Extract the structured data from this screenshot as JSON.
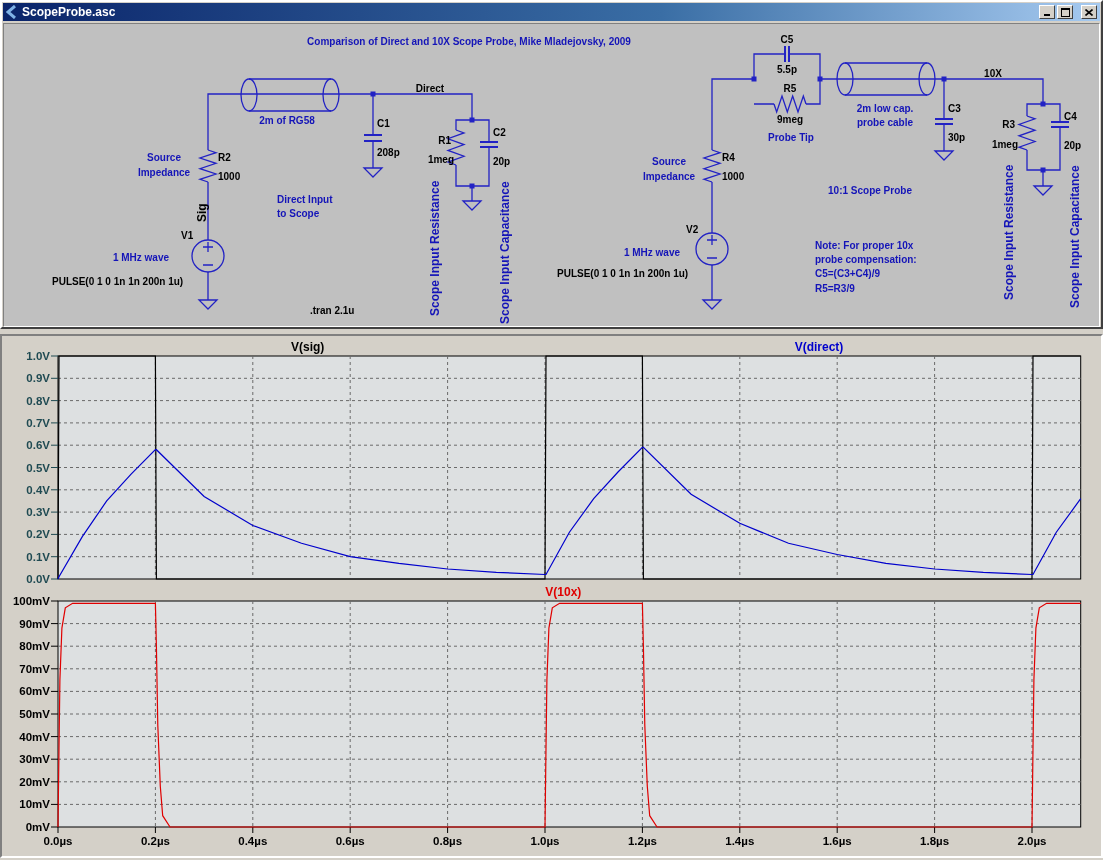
{
  "window": {
    "title": "ScopeProbe.asc"
  },
  "schematic": {
    "title": "Comparison of Direct and 10X Scope Probe, Mike Mladejovsky, 2009",
    "labels": [
      {
        "text": "2m of RG58",
        "kind": "comment",
        "vertical": false
      },
      {
        "text": "Direct",
        "kind": "net",
        "vertical": false
      },
      {
        "text": "C1",
        "kind": "part",
        "vertical": false
      },
      {
        "text": "208p",
        "kind": "part",
        "vertical": false
      },
      {
        "text": "R1",
        "kind": "part",
        "vertical": false
      },
      {
        "text": "1meg",
        "kind": "part",
        "vertical": false
      },
      {
        "text": "C2",
        "kind": "part",
        "vertical": false
      },
      {
        "text": "20p",
        "kind": "part",
        "vertical": false
      },
      {
        "text": "Scope Input Resistance",
        "kind": "comment",
        "vertical": true
      },
      {
        "text": "Scope Input Capacitance",
        "kind": "comment",
        "vertical": true
      },
      {
        "text": "Source",
        "kind": "comment",
        "vertical": false
      },
      {
        "text": "Impedance",
        "kind": "comment",
        "vertical": false
      },
      {
        "text": "R2",
        "kind": "part",
        "vertical": false
      },
      {
        "text": "1000",
        "kind": "part",
        "vertical": false
      },
      {
        "text": "Sig",
        "kind": "net",
        "vertical": true
      },
      {
        "text": "Direct Input",
        "kind": "comment",
        "vertical": false
      },
      {
        "text": "to Scope",
        "kind": "comment",
        "vertical": false
      },
      {
        "text": "V1",
        "kind": "part",
        "vertical": false
      },
      {
        "text": "1 MHz wave",
        "kind": "comment",
        "vertical": false
      },
      {
        "text": "PULSE(0 1 0 1n 1n 200n 1u)",
        "kind": "part",
        "vertical": false
      },
      {
        "text": ".tran 2.1u",
        "kind": "directive",
        "vertical": false
      },
      {
        "text": "C5",
        "kind": "part",
        "vertical": false
      },
      {
        "text": "5.5p",
        "kind": "part",
        "vertical": false
      },
      {
        "text": "R5",
        "kind": "part",
        "vertical": false
      },
      {
        "text": "9meg",
        "kind": "part",
        "vertical": false
      },
      {
        "text": "Probe Tip",
        "kind": "comment",
        "vertical": false
      },
      {
        "text": "2m low cap.",
        "kind": "comment",
        "vertical": false
      },
      {
        "text": "probe cable",
        "kind": "comment",
        "vertical": false
      },
      {
        "text": "10X",
        "kind": "net",
        "vertical": false
      },
      {
        "text": "C3",
        "kind": "part",
        "vertical": false
      },
      {
        "text": "30p",
        "kind": "part",
        "vertical": false
      },
      {
        "text": "R3",
        "kind": "part",
        "vertical": false
      },
      {
        "text": "1meg",
        "kind": "part",
        "vertical": false
      },
      {
        "text": "C4",
        "kind": "part",
        "vertical": false
      },
      {
        "text": "20p",
        "kind": "part",
        "vertical": false
      },
      {
        "text": "Scope Input Resistance",
        "kind": "comment",
        "vertical": true
      },
      {
        "text": "Scope Input Capacitance",
        "kind": "comment",
        "vertical": true
      },
      {
        "text": "Source",
        "kind": "comment",
        "vertical": false
      },
      {
        "text": "Impedance",
        "kind": "comment",
        "vertical": false
      },
      {
        "text": "R4",
        "kind": "part",
        "vertical": false
      },
      {
        "text": "1000",
        "kind": "part",
        "vertical": false
      },
      {
        "text": "10:1 Scope Probe",
        "kind": "comment",
        "vertical": false
      },
      {
        "text": "V2",
        "kind": "part",
        "vertical": false
      },
      {
        "text": "1 MHz wave",
        "kind": "comment",
        "vertical": false
      },
      {
        "text": "Note: For proper 10x",
        "kind": "comment",
        "vertical": false
      },
      {
        "text": "probe compensation:",
        "kind": "comment",
        "vertical": false
      },
      {
        "text": "C5=(C3+C4)/9",
        "kind": "comment",
        "vertical": false
      },
      {
        "text": "R5=R3/9",
        "kind": "comment",
        "vertical": false
      },
      {
        "text": "PULSE(0 1 0 1n 1n 200n 1u)",
        "kind": "part",
        "vertical": false
      }
    ]
  },
  "plots": [
    {
      "chart_data": {
        "type": "line",
        "grid": true,
        "xlim": [
          0,
          2.1
        ],
        "ylim": [
          0,
          1
        ],
        "x": [
          0,
          0.002,
          0.05,
          0.1,
          0.15,
          0.2,
          0.202,
          0.3,
          0.4,
          0.5,
          0.6,
          0.7,
          0.8,
          0.9,
          1.0,
          1.002,
          1.05,
          1.1,
          1.15,
          1.2,
          1.202,
          1.3,
          1.4,
          1.5,
          1.6,
          1.7,
          1.8,
          1.9,
          2.0,
          2.002,
          2.05,
          2.1
        ],
        "yticks": [
          {
            "value": 0,
            "label": "0.0V"
          },
          {
            "value": 0.1,
            "label": "0.1V"
          },
          {
            "value": 0.2,
            "label": "0.2V"
          },
          {
            "value": 0.3,
            "label": "0.3V"
          },
          {
            "value": 0.4,
            "label": "0.4V"
          },
          {
            "value": 0.5,
            "label": "0.5V"
          },
          {
            "value": 0.6,
            "label": "0.6V"
          },
          {
            "value": 0.7,
            "label": "0.7V"
          },
          {
            "value": 0.8,
            "label": "0.8V"
          },
          {
            "value": 0.9,
            "label": "0.9V"
          },
          {
            "value": 1.0,
            "label": "1.0V"
          }
        ],
        "series": [
          {
            "name": "V(sig)",
            "color": "#000000",
            "values": [
              0,
              1,
              1,
              1,
              1,
              1,
              0,
              0,
              0,
              0,
              0,
              0,
              0,
              0,
              0,
              1,
              1,
              1,
              1,
              1,
              0,
              0,
              0,
              0,
              0,
              0,
              0,
              0,
              0,
              1,
              1,
              1
            ]
          },
          {
            "name": "V(direct)",
            "color": "#0000cc",
            "values": [
              0,
              0.01,
              0.19,
              0.35,
              0.47,
              0.58,
              0.58,
              0.37,
              0.24,
              0.16,
              0.1,
              0.07,
              0.045,
              0.03,
              0.02,
              0.02,
              0.21,
              0.36,
              0.48,
              0.59,
              0.59,
              0.38,
              0.25,
              0.16,
              0.11,
              0.07,
              0.045,
              0.03,
              0.02,
              0.02,
              0.21,
              0.36
            ]
          }
        ]
      }
    },
    {
      "chart_data": {
        "type": "line",
        "grid": true,
        "xlim": [
          0,
          2.1
        ],
        "ylim": [
          0,
          100
        ],
        "x": [
          0,
          0.002,
          0.004,
          0.008,
          0.015,
          0.03,
          0.2,
          0.202,
          0.205,
          0.21,
          0.215,
          0.23,
          1.0,
          1.002,
          1.004,
          1.008,
          1.015,
          1.03,
          1.2,
          1.202,
          1.205,
          1.21,
          1.215,
          1.23,
          2.0,
          2.002,
          2.004,
          2.008,
          2.015,
          2.03,
          2.1
        ],
        "xticks": [
          {
            "value": 0,
            "label": "0.0µs"
          },
          {
            "value": 0.2,
            "label": "0.2µs"
          },
          {
            "value": 0.4,
            "label": "0.4µs"
          },
          {
            "value": 0.6,
            "label": "0.6µs"
          },
          {
            "value": 0.8,
            "label": "0.8µs"
          },
          {
            "value": 1.0,
            "label": "1.0µs"
          },
          {
            "value": 1.2,
            "label": "1.2µs"
          },
          {
            "value": 1.4,
            "label": "1.4µs"
          },
          {
            "value": 1.6,
            "label": "1.6µs"
          },
          {
            "value": 1.8,
            "label": "1.8µs"
          },
          {
            "value": 2.0,
            "label": "2.0µs"
          }
        ],
        "yticks": [
          {
            "value": 0,
            "label": "0mV"
          },
          {
            "value": 10,
            "label": "10mV"
          },
          {
            "value": 20,
            "label": "20mV"
          },
          {
            "value": 30,
            "label": "30mV"
          },
          {
            "value": 40,
            "label": "40mV"
          },
          {
            "value": 50,
            "label": "50mV"
          },
          {
            "value": 60,
            "label": "60mV"
          },
          {
            "value": 70,
            "label": "70mV"
          },
          {
            "value": 80,
            "label": "80mV"
          },
          {
            "value": 90,
            "label": "90mV"
          },
          {
            "value": 100,
            "label": "100mV"
          }
        ],
        "series": [
          {
            "name": "V(10x)",
            "color": "#e00000",
            "values": [
              0,
              35,
              65,
              88,
              97,
              99,
              99,
              80,
              45,
              18,
              5,
              0,
              0,
              35,
              65,
              88,
              97,
              99,
              99,
              80,
              45,
              18,
              5,
              0,
              0,
              35,
              65,
              88,
              97,
              99,
              99
            ]
          }
        ]
      }
    }
  ]
}
